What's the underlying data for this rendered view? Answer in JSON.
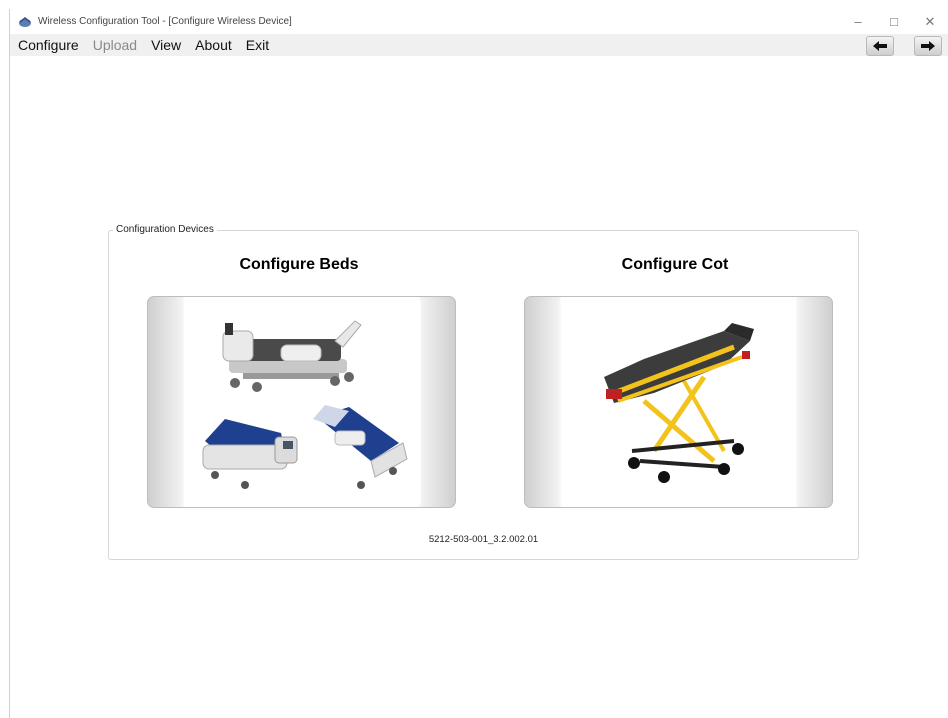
{
  "window": {
    "title": "Wireless Configuration Tool - [Configure Wireless Device]",
    "controls": {
      "minimize": "–",
      "maximize": "□",
      "close": "✕"
    }
  },
  "menu": [
    {
      "label": "Configure",
      "enabled": true
    },
    {
      "label": "Upload",
      "enabled": false
    },
    {
      "label": "View",
      "enabled": true
    },
    {
      "label": "About",
      "enabled": true
    },
    {
      "label": "Exit",
      "enabled": true
    }
  ],
  "nav": {
    "back_icon": "arrow-left-icon",
    "forward_icon": "arrow-right-icon"
  },
  "group": {
    "legend": "Configuration Devices",
    "beds": {
      "title": "Configure Beds",
      "image": "hospital-beds-image"
    },
    "cot": {
      "title": "Configure Cot",
      "image": "ambulance-cot-image"
    },
    "version": "5212-503-001_3.2.002.01"
  },
  "colors": {
    "menubar_bg": "#f0f0f0",
    "cot_yellow": "#f2c31b",
    "bed_blue": "#1f3f8f"
  }
}
